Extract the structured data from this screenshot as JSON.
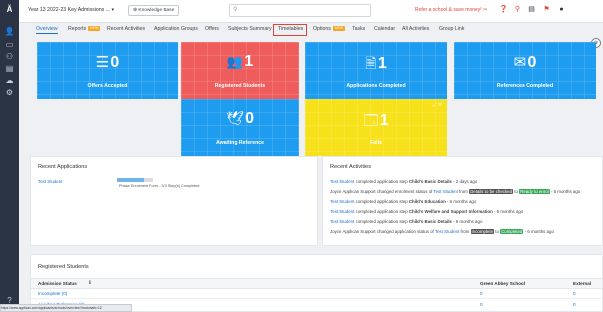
{
  "header": {
    "title": "Year 13 2022-23 Key Admissions ...",
    "knowledge_base": "Knowledge Base",
    "refer": "Refer a school & save money!"
  },
  "tabs": [
    {
      "label": "Overview"
    },
    {
      "label": "Reports",
      "badge": "NEW"
    },
    {
      "label": "Recent Activities"
    },
    {
      "label": "Application Groups"
    },
    {
      "label": "Offers"
    },
    {
      "label": "Subjects Summary"
    },
    {
      "label": "Timetables"
    },
    {
      "label": "Options",
      "badge": "NEW"
    },
    {
      "label": "Tasks"
    },
    {
      "label": "Calendar"
    },
    {
      "label": "All Activities"
    },
    {
      "label": "Group Link"
    }
  ],
  "tiles": [
    {
      "icon": "☰",
      "value": "0",
      "label": "Offers Accepted",
      "color": "#1e9cf0"
    },
    {
      "icon": "👥",
      "value": "1",
      "label": "Registered Students",
      "color": "#ef5c5c"
    },
    {
      "icon": "🗎",
      "value": "1",
      "label": "Applications Completed",
      "color": "#1e9cf0"
    },
    {
      "icon": "✉",
      "value": "0",
      "label": "References Completed",
      "color": "#1e9cf0"
    },
    {
      "icon": "🕊",
      "value": "0",
      "label": "Awaiting Reference",
      "color": "#1e9cf0"
    },
    {
      "icon": "🗔",
      "value": "1",
      "label": "Fails",
      "color": "#f7e11a"
    }
  ],
  "recent_applications": {
    "title": "Recent Applications",
    "student": "Test Student",
    "progress": 0.75,
    "stage": "Phase Enrolment Form - 3/3 Step(s) Completed"
  },
  "recent_activities": {
    "title": "Recent Activities",
    "items": [
      {
        "pre": "Test Student",
        "text": " completed application step ",
        "bold": "Child's Basic Details",
        "post": " - 2 days ago"
      },
      {
        "pre": "Joyce Applicas Support",
        "text": " changed enrolment status of ",
        "link": "Test Student",
        "from": "Details to be checked",
        "to": "Ready to enrol",
        "post": " - 5 months ago"
      },
      {
        "pre": "Test Student",
        "text": " completed application step ",
        "bold": "Child's Education",
        "post": " - 6 months ago"
      },
      {
        "pre": "Test Student",
        "text": " completed application step ",
        "bold": "Child's Welfare and Support Information",
        "post": " - 6 months ago"
      },
      {
        "pre": "Test Student",
        "text": " completed application step ",
        "bold": "Child's Basic Details",
        "post": " - 6 months ago"
      },
      {
        "pre": "Joyce Applicas Support",
        "text": " changed application status of ",
        "link": "Test Student",
        "from": "Incomplete",
        "to": "Completed",
        "post": " - 6 months ago"
      }
    ]
  },
  "registered": {
    "title": "Registered Students",
    "columns": [
      "Admission Status",
      "Green Abbey School",
      "External"
    ],
    "rows": [
      {
        "status": "Incomplete (0)",
        "green": "0",
        "external": "0"
      },
      {
        "status": "Awaiting Reference (0)",
        "green": "0",
        "external": "0"
      }
    ]
  },
  "statusbar": "https://www.applicas.com/applicants/schools/overview?bookmark=12"
}
